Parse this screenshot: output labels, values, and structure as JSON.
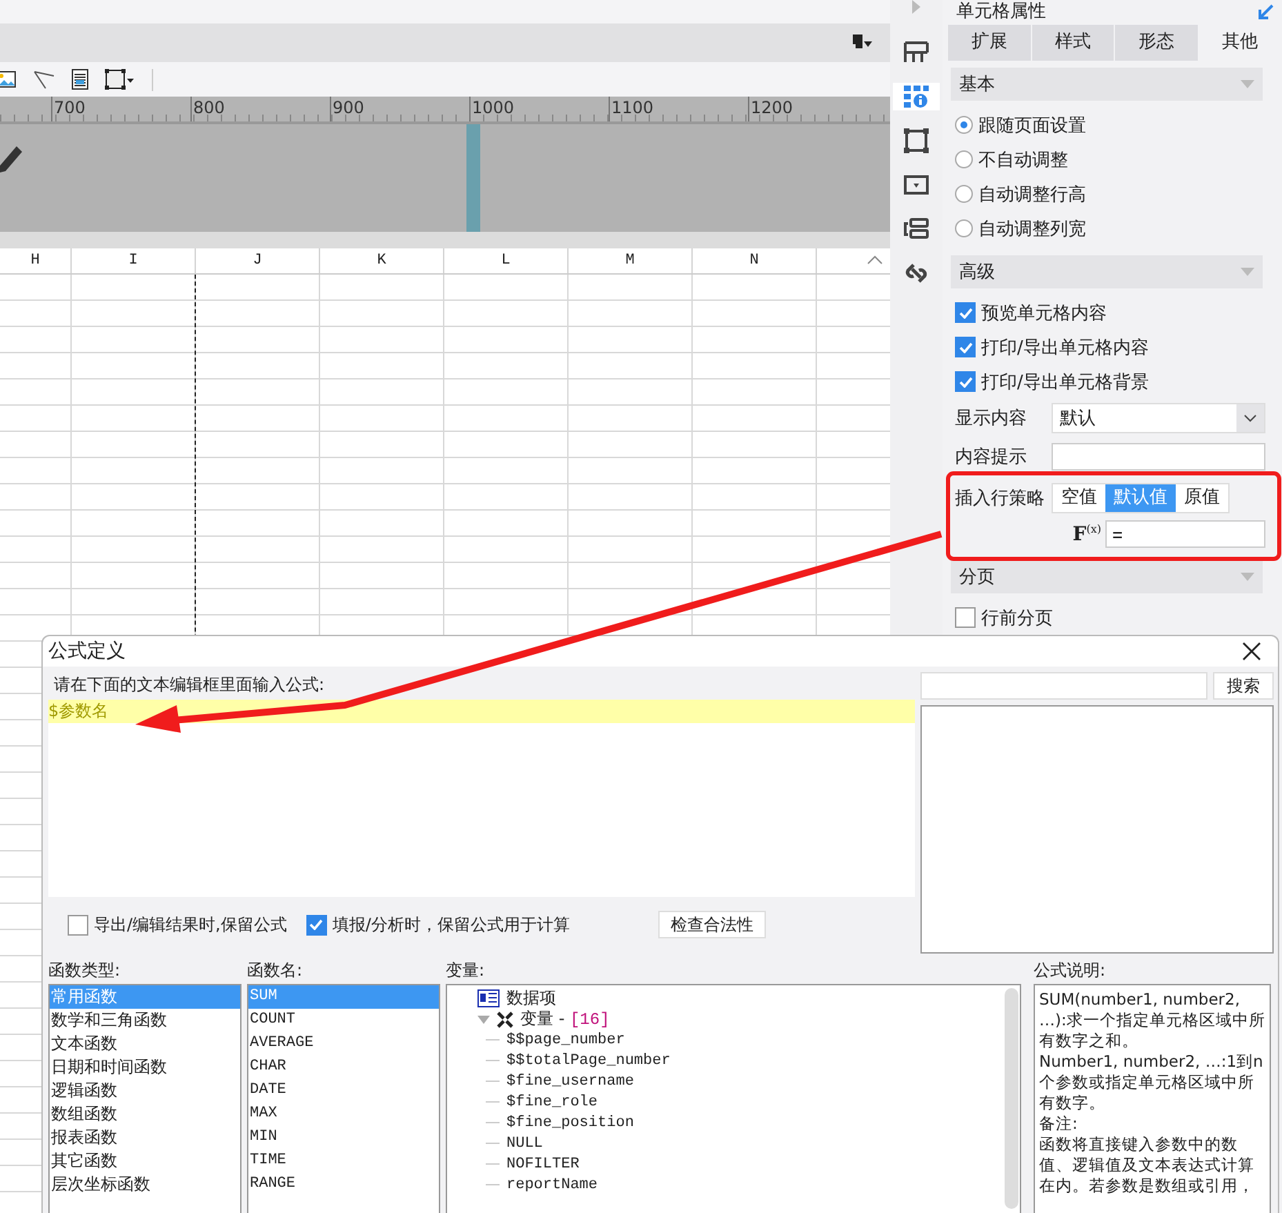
{
  "ruler": {
    "ticks": [
      "700",
      "800",
      "900",
      "1000",
      "1100",
      "1200"
    ]
  },
  "sheet": {
    "columns": [
      "H",
      "I",
      "J",
      "K",
      "L",
      "M",
      "N"
    ]
  },
  "side_tabs": [
    {
      "selected": false
    },
    {
      "selected": true
    },
    {
      "selected": false
    },
    {
      "selected": false
    },
    {
      "selected": false
    },
    {
      "selected": false
    }
  ],
  "panel": {
    "title": "单元格属性",
    "tabs": [
      {
        "label": "扩展",
        "selected": false
      },
      {
        "label": "样式",
        "selected": false
      },
      {
        "label": "形态",
        "selected": false
      },
      {
        "label": "其他",
        "selected": true
      }
    ],
    "basic": {
      "title": "基本",
      "options": [
        {
          "label": "跟随页面设置",
          "selected": true
        },
        {
          "label": "不自动调整",
          "selected": false
        },
        {
          "label": "自动调整行高",
          "selected": false
        },
        {
          "label": "自动调整列宽",
          "selected": false
        }
      ]
    },
    "advanced": {
      "title": "高级",
      "checks": [
        {
          "label": "预览单元格内容",
          "checked": true
        },
        {
          "label": "打印/导出单元格内容",
          "checked": true
        },
        {
          "label": "打印/导出单元格背景",
          "checked": true
        }
      ],
      "display_content": {
        "label": "显示内容",
        "value": "默认"
      },
      "content_hint": {
        "label": "内容提示"
      },
      "insert_row_policy": {
        "label": "插入行策略",
        "options": [
          {
            "label": "空值",
            "selected": false
          },
          {
            "label": "默认值",
            "selected": true
          },
          {
            "label": "原值",
            "selected": false
          }
        ],
        "formula_button": "F$^{(x)}$",
        "formula_value": "="
      }
    },
    "paging": {
      "title": "分页",
      "checks": [
        {
          "label": "行前分页",
          "checked": false
        }
      ]
    }
  },
  "dialog": {
    "title": "公式定义",
    "prompt": "请在下面的文本编辑框里面输入公式:",
    "formula": "$参数名",
    "search_button": "搜索",
    "options": [
      {
        "label": "导出/编辑结果时,保留公式",
        "checked": false
      },
      {
        "label": "填报/分析时，保留公式用于计算",
        "checked": true
      }
    ],
    "check_button": "检查合法性",
    "function_types": {
      "label": "函数类型:",
      "items": [
        {
          "label": "常用函数",
          "selected": true
        },
        {
          "label": "数学和三角函数",
          "selected": false
        },
        {
          "label": "文本函数",
          "selected": false
        },
        {
          "label": "日期和时间函数",
          "selected": false
        },
        {
          "label": "逻辑函数",
          "selected": false
        },
        {
          "label": "数组函数",
          "selected": false
        },
        {
          "label": "报表函数",
          "selected": false
        },
        {
          "label": "其它函数",
          "selected": false
        },
        {
          "label": "层次坐标函数",
          "selected": false
        }
      ]
    },
    "function_names": {
      "label": "函数名:",
      "items": [
        {
          "label": "SUM",
          "selected": true
        },
        {
          "label": "COUNT",
          "selected": false
        },
        {
          "label": "AVERAGE",
          "selected": false
        },
        {
          "label": "CHAR",
          "selected": false
        },
        {
          "label": "DATE",
          "selected": false
        },
        {
          "label": "MAX",
          "selected": false
        },
        {
          "label": "MIN",
          "selected": false
        },
        {
          "label": "TIME",
          "selected": false
        },
        {
          "label": "RANGE",
          "selected": false
        }
      ]
    },
    "variables": {
      "label": "变量:",
      "tree": [
        {
          "label": "数据项",
          "kind": "data"
        },
        {
          "label": "变量 - ",
          "count": "[16]",
          "kind": "group",
          "expanded": true,
          "children": [
            {
              "label": "$$page_number",
              "kind": "var"
            },
            {
              "label": "$$totalPage_number",
              "kind": "var"
            },
            {
              "label": "$fine_username",
              "kind": "var"
            },
            {
              "label": "$fine_role",
              "kind": "var"
            },
            {
              "label": "$fine_position",
              "kind": "var"
            },
            {
              "label": "NULL",
              "kind": "var"
            },
            {
              "label": "NOFILTER",
              "kind": "var"
            },
            {
              "label": "reportName",
              "kind": "var"
            }
          ]
        }
      ]
    },
    "description": {
      "label": "公式说明:",
      "paragraphs": [
        "SUM(number1, number2, …):求一个指定单元格区域中所有数字之和。",
        "Number1, number2, …:1到n个参数或指定单元格区域中所有数字。",
        "备注:",
        "函数将直接键入参数中的数值、逻辑值及文本表达式计算在内。若参数是数组或引用，"
      ]
    }
  }
}
